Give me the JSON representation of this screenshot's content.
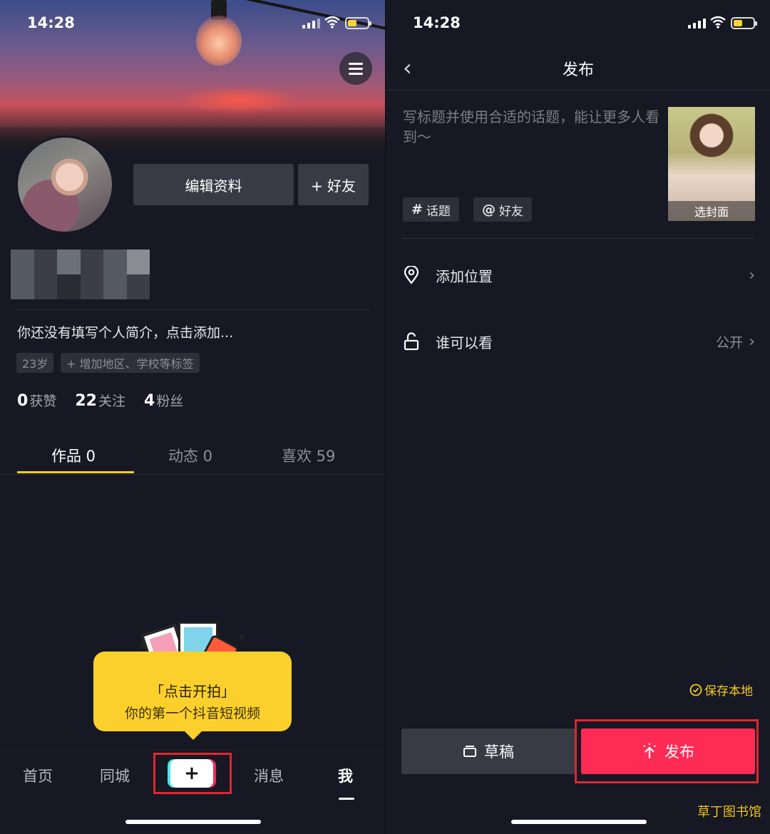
{
  "left": {
    "status": {
      "time": "14:28"
    },
    "profile": {
      "edit_label": "编辑资料",
      "add_friend_label": "+ 好友",
      "bio": "你还没有填写个人简介，点击添加...",
      "tags": [
        "23岁",
        "+ 增加地区、学校等标签"
      ],
      "stats": [
        {
          "value": "0",
          "label": "获赞"
        },
        {
          "value": "22",
          "label": "关注"
        },
        {
          "value": "4",
          "label": "粉丝"
        }
      ]
    },
    "tabs": [
      {
        "label": "作品 0",
        "active": true
      },
      {
        "label": "动态 0",
        "active": false
      },
      {
        "label": "喜欢 59",
        "active": false
      }
    ],
    "bubble": {
      "line1": "「点击开拍」",
      "line2": "你的第一个抖音短视频"
    },
    "nav": [
      {
        "label": "首页",
        "active": false
      },
      {
        "label": "同城",
        "active": false
      },
      {
        "label": "+",
        "active": false
      },
      {
        "label": "消息",
        "active": false
      },
      {
        "label": "我",
        "active": true
      }
    ]
  },
  "right": {
    "status": {
      "time": "14:28"
    },
    "title": "发布",
    "placeholder": "写标题并使用合适的话题，能让更多人看到～",
    "cover_caption": "选封面",
    "chips": [
      {
        "symbol": "#",
        "label": "话题"
      },
      {
        "symbol": "@",
        "label": "好友"
      }
    ],
    "rows": [
      {
        "label": "添加位置",
        "value": "",
        "icon": "location-pin-icon"
      },
      {
        "label": "谁可以看",
        "value": "公开",
        "icon": "unlock-icon"
      }
    ],
    "save_local": "保存本地",
    "draft_label": "草稿",
    "publish_label": "发布",
    "watermark": "草丁图书馆"
  },
  "colors": {
    "background": "#161823",
    "accent_yellow": "#fcd02c",
    "publish_red": "#fe2c55",
    "highlight_red": "#e2262d"
  }
}
